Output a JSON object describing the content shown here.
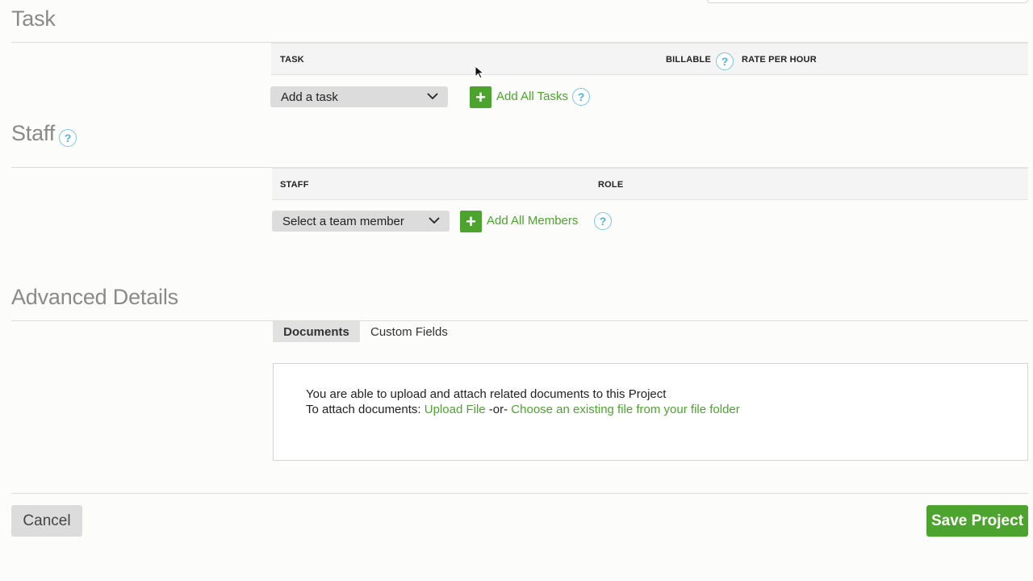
{
  "task": {
    "title": "Task",
    "columns": {
      "task": "TASK",
      "billable": "BILLABLE",
      "rate": "RATE PER HOUR"
    },
    "select_value": "Add a task",
    "add_all_label": "Add All Tasks"
  },
  "staff": {
    "title": "Staff",
    "columns": {
      "staff": "STAFF",
      "role": "ROLE"
    },
    "select_value": "Select a team member",
    "add_all_label": "Add All Members"
  },
  "advanced": {
    "title": "Advanced Details",
    "tabs": [
      {
        "label": "Documents",
        "active": true
      },
      {
        "label": "Custom Fields",
        "active": false
      }
    ],
    "documents": {
      "line1": "You are able to upload and attach related documents to this Project",
      "line2_prefix": "To attach documents: ",
      "upload_link": "Upload File",
      "separator": " -or- ",
      "choose_link": "Choose an existing file from your file folder"
    }
  },
  "footer": {
    "cancel_label": "Cancel",
    "save_label": "Save Project"
  },
  "help_glyph": "?",
  "plus_glyph": "+",
  "colors": {
    "accent_green": "#4ca42e",
    "help_blue": "#4fb3de"
  }
}
